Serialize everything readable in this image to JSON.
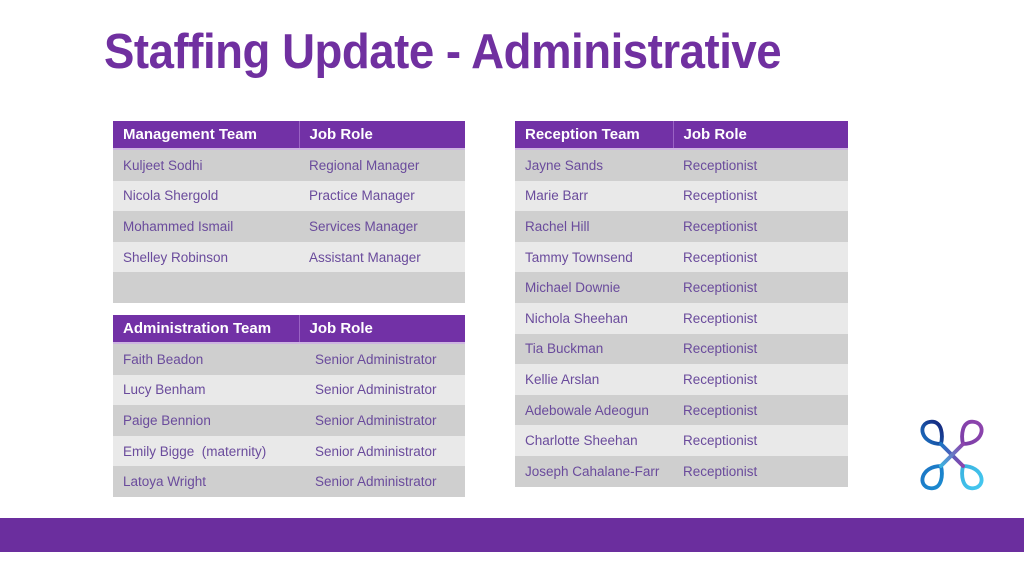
{
  "slide": {
    "title": "Staffing Update - Administrative",
    "title_color": "#7030A0",
    "footer_color": "#6B2E9E",
    "header_color": "#7231A6",
    "row_dark_color": "#CFCFCF",
    "row_light_color": "#E9E9E9",
    "cell_text_color": "#6A4B9C",
    "logo_name": "clover-knot-logo"
  },
  "tables": {
    "management": {
      "headers": [
        "Management Team",
        "Job Role"
      ],
      "rows": [
        [
          "Kuljeet Sodhi",
          "Regional Manager"
        ],
        [
          "Nicola Shergold",
          "Practice Manager"
        ],
        [
          "Mohammed Ismail",
          "Services Manager"
        ],
        [
          "Shelley Robinson",
          "Assistant Manager"
        ],
        [
          "",
          ""
        ]
      ]
    },
    "administration": {
      "headers": [
        "Administration Team",
        "Job Role"
      ],
      "rows": [
        [
          "Faith Beadon",
          "Senior Administrator"
        ],
        [
          "Lucy Benham",
          "Senior Administrator"
        ],
        [
          "Paige Bennion",
          "Senior Administrator"
        ],
        [
          "Emily Bigge  (maternity)",
          "Senior Administrator"
        ],
        [
          "Latoya Wright",
          "Senior Administrator"
        ]
      ]
    },
    "reception": {
      "headers": [
        "Reception Team",
        "Job Role"
      ],
      "rows": [
        [
          "Jayne Sands",
          "Receptionist"
        ],
        [
          "Marie Barr",
          "Receptionist"
        ],
        [
          "Rachel Hill",
          "Receptionist"
        ],
        [
          "Tammy Townsend",
          "Receptionist"
        ],
        [
          "Michael Downie",
          "Receptionist"
        ],
        [
          "Nichola Sheehan",
          "Receptionist"
        ],
        [
          "Tia Buckman",
          "Receptionist"
        ],
        [
          "Kellie Arslan",
          "Receptionist"
        ],
        [
          "Adebowale Adeogun",
          "Receptionist"
        ],
        [
          "Charlotte Sheehan",
          "Receptionist"
        ],
        [
          "Joseph Cahalane-Farr",
          "Receptionist"
        ]
      ]
    }
  }
}
